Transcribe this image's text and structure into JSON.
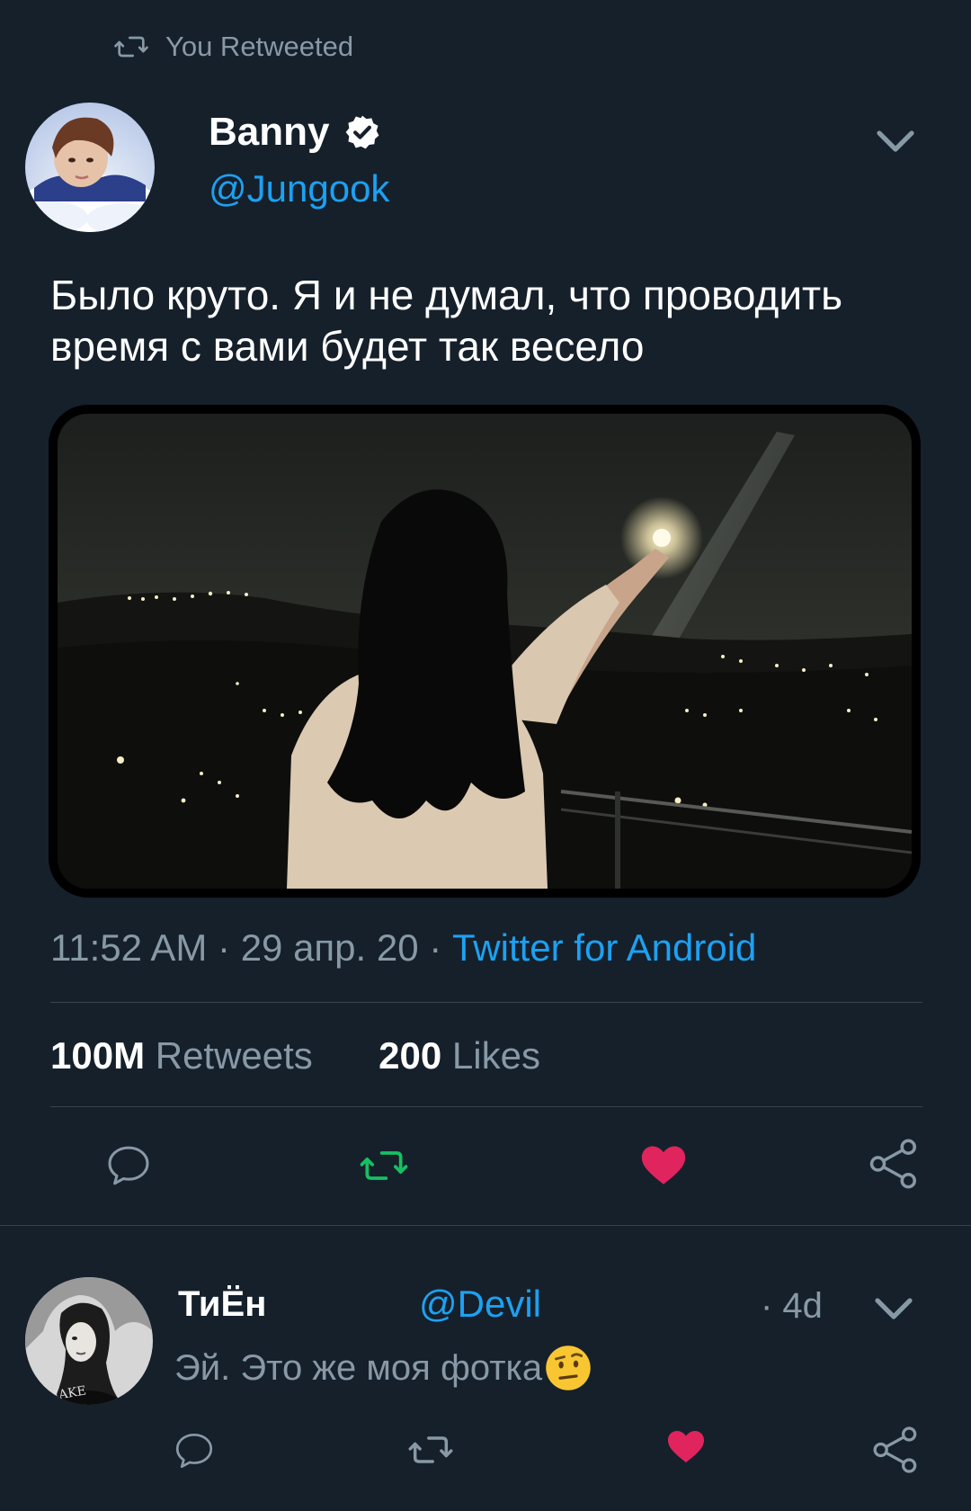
{
  "retweet_header": {
    "label": "You Retweeted",
    "icon": "retweet-icon"
  },
  "tweet": {
    "display_name": "Banny",
    "handle": "@Jungook",
    "verified": true,
    "text_line1": "Было круто. Я и не думал, что проводить",
    "text_line2": "время с вами будет так весело",
    "time": "11:52 AM",
    "date": "29 апр. 20",
    "source": "Twitter for Android",
    "separator": "·",
    "retweets_count": "100M",
    "retweets_label": "Retweets",
    "likes_count": "200",
    "likes_label": "Likes"
  },
  "reply": {
    "display_name": "ТиЁн",
    "handle": "@Devil",
    "time": "· 4d",
    "text": "Эй. Это же моя фотка"
  },
  "colors": {
    "background": "#15202b",
    "accent": "#1da1f2",
    "muted": "#8899a6",
    "retweet_active": "#17bf63",
    "like_active": "#e0245e"
  }
}
